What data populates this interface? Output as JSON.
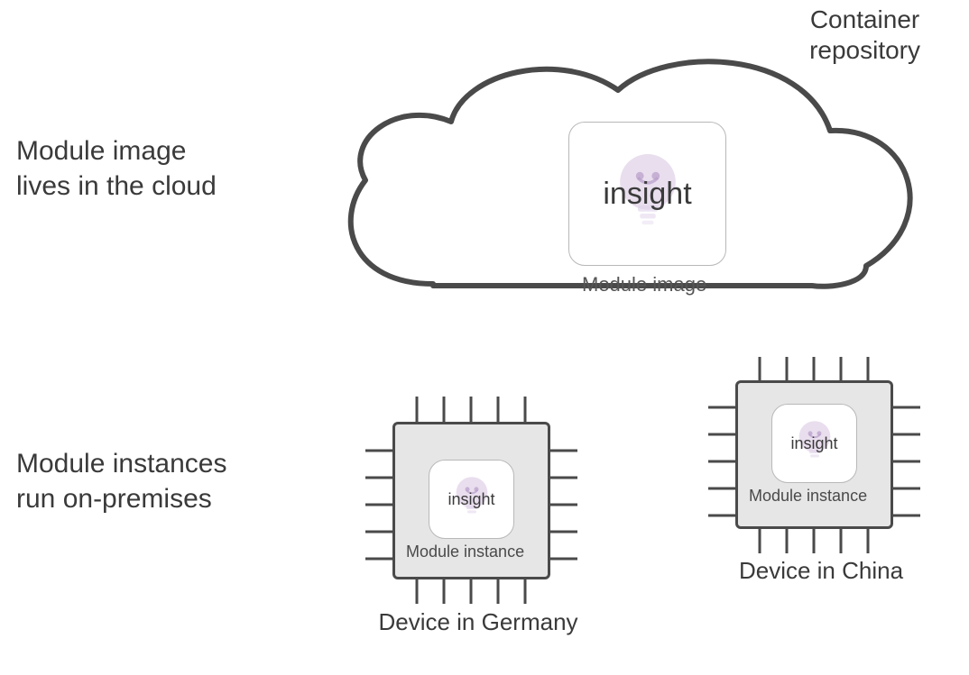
{
  "left_labels": {
    "cloud": "Module image\nlives in the cloud",
    "onprem": "Module instances\nrun on-premises"
  },
  "cloud": {
    "title": "Container\nrepository",
    "module_word": "insight",
    "module_caption": "Module image"
  },
  "chips": {
    "germany": {
      "device_label": "Device in Germany",
      "module_word": "insight",
      "instance_caption": "Module instance"
    },
    "china": {
      "device_label": "Device in China",
      "module_word": "insight",
      "instance_caption": "Module instance"
    }
  },
  "colors": {
    "stroke": "#4a4a4a",
    "chip_fill": "#e6e6e6",
    "bulb": "#d7c3e0"
  }
}
